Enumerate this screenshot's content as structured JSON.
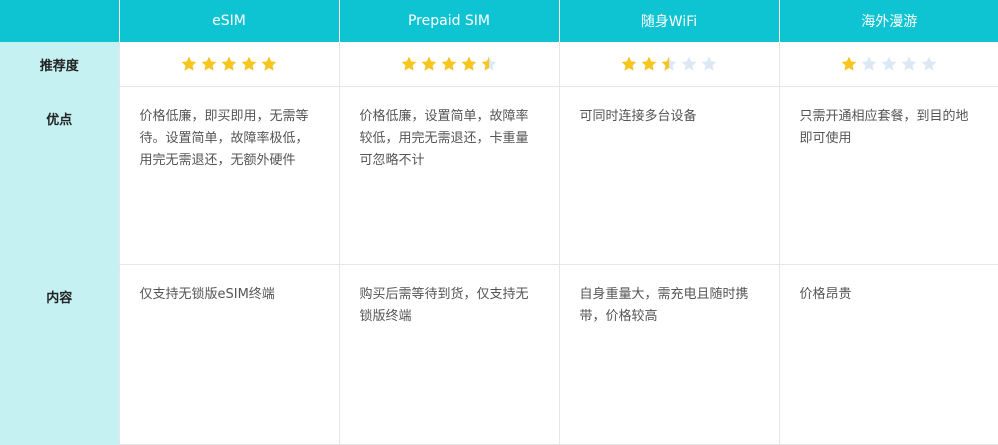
{
  "header": {
    "columns": [
      "eSIM",
      "Prepaid SIM",
      "随身WiFi",
      "海外漫游"
    ]
  },
  "rows": [
    {
      "label": "推荐度",
      "ratings": [
        5,
        4.5,
        2.5,
        1
      ],
      "max": 5
    },
    {
      "label": "优点",
      "cells": [
        "价格低廉，即买即用，无需等待。设置简单，故障率极低，用完无需退还，无额外硬件",
        "价格低廉，设置简单，故障率较低，用完无需退还，卡重量可忽略不计",
        "可同时连接多台设备",
        "只需开通相应套餐，到目的地即可使用"
      ]
    },
    {
      "label": "内容",
      "cells": [
        "仅支持无锁版eSIM终端",
        "购买后需等待到货，仅支持无锁版终端",
        "自身重量大，需充电且随时携带，价格较高",
        "价格昂贵"
      ]
    }
  ],
  "colors": {
    "header_bg": "#0ec3d2",
    "row_header_bg": "#c6f1f3",
    "star_filled": "#f7c51c",
    "star_empty": "#dde8f5"
  }
}
